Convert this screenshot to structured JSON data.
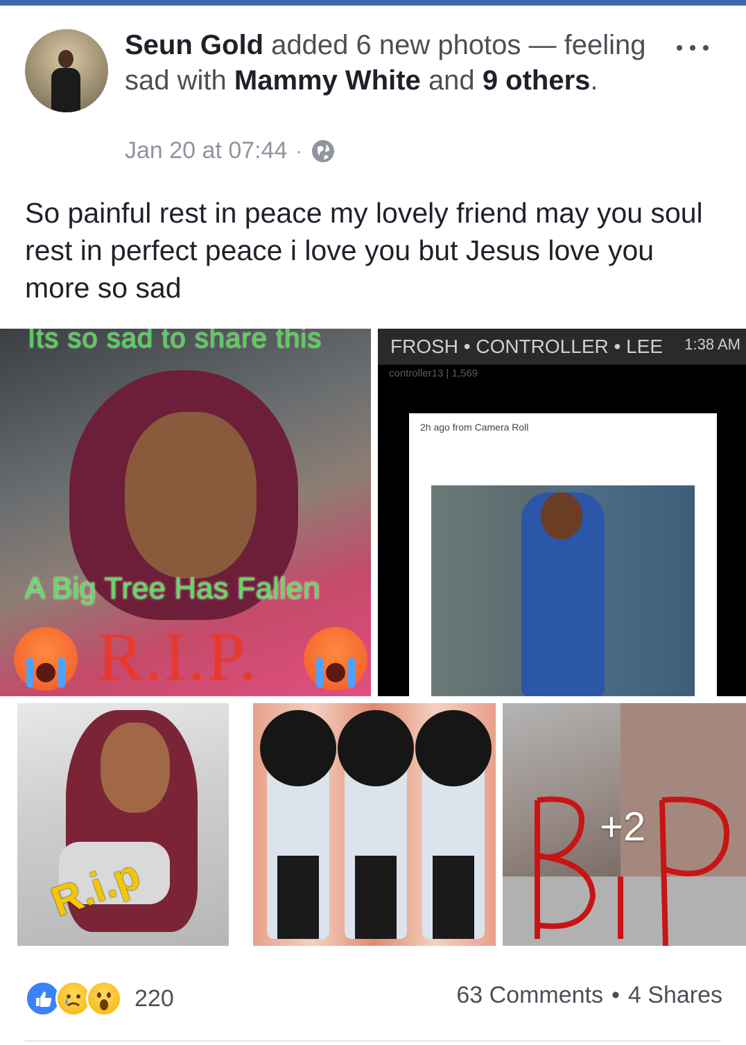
{
  "post": {
    "author": "Seun Gold",
    "action": "added 6 new photos — feeling sad with",
    "tagged_first": "Mammy White",
    "and": "and",
    "others_label": "9 others",
    "period": ".",
    "timestamp": "Jan 20 at 07:44",
    "separator": "·",
    "privacy_icon": "globe-icon",
    "more_icon": "more-horizontal-icon",
    "text": "So painful rest in peace my lovely friend may you soul rest in perfect peace i love you but Jesus love you more so sad"
  },
  "photos": {
    "p1": {
      "caption_top": "Its so sad to share this",
      "caption_mid": "A Big Tree Has Fallen",
      "caption_rip": "R.I.P."
    },
    "p2": {
      "status_bar": "FROSH • CONTROLLER • LEE",
      "status_time": "1:38 AM",
      "sub_status": "controller13 | 1,569",
      "card_caption": "2h ago from Camera Roll"
    },
    "p3": {
      "rip_text": "R.i.p"
    },
    "p5": {
      "more_count": "+2"
    }
  },
  "footer": {
    "reaction_icons": [
      "like-icon",
      "sad-icon",
      "wow-icon"
    ],
    "reaction_count": "220",
    "comments": "63 Comments",
    "dot": "•",
    "shares": "4 Shares"
  },
  "colors": {
    "brand_bar": "#4267b2",
    "like_blue": "#3b82f6",
    "meta_gray": "#90949c"
  }
}
